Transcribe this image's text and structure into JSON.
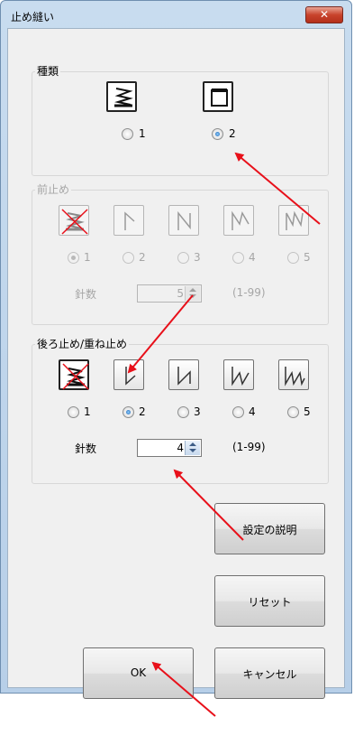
{
  "dialog": {
    "title": "止め縫い",
    "close_symbol": "✕"
  },
  "kind": {
    "legend": "種類",
    "options": [
      {
        "label": "1",
        "icon": "zigzag-stitch-icon",
        "selected": false
      },
      {
        "label": "2",
        "icon": "square-stitch-icon",
        "selected": true
      }
    ]
  },
  "front_stop": {
    "legend": "前止め",
    "enabled": false,
    "options": [
      {
        "label": "1",
        "icon": "no-tack-icon",
        "selected": true
      },
      {
        "label": "2",
        "icon": "tack-pattern-2-icon",
        "selected": false
      },
      {
        "label": "3",
        "icon": "tack-pattern-3-icon",
        "selected": false
      },
      {
        "label": "4",
        "icon": "tack-pattern-4-icon",
        "selected": false
      },
      {
        "label": "5",
        "icon": "tack-pattern-5-icon",
        "selected": false
      }
    ],
    "stitch_label": "針数",
    "stitch_value": "5",
    "range": "(1-99)"
  },
  "back_stop": {
    "legend": "後ろ止め/重ね止め",
    "enabled": true,
    "options": [
      {
        "label": "1",
        "icon": "no-tack-icon",
        "selected": false
      },
      {
        "label": "2",
        "icon": "tack-pattern-2-icon",
        "selected": true
      },
      {
        "label": "3",
        "icon": "tack-pattern-3-icon",
        "selected": false
      },
      {
        "label": "4",
        "icon": "tack-pattern-4-icon",
        "selected": false
      },
      {
        "label": "5",
        "icon": "tack-pattern-5-icon",
        "selected": false
      }
    ],
    "stitch_label": "針数",
    "stitch_value": "4",
    "range": "(1-99)"
  },
  "buttons": {
    "explain": "設定の説明",
    "reset": "リセット",
    "ok": "OK",
    "cancel": "キャンセル"
  },
  "colors": {
    "annotation_arrow": "#e8101a",
    "no_tack_cross": "#e8101a",
    "title_bar": "#c8dcef",
    "close_button": "#c8432c"
  }
}
